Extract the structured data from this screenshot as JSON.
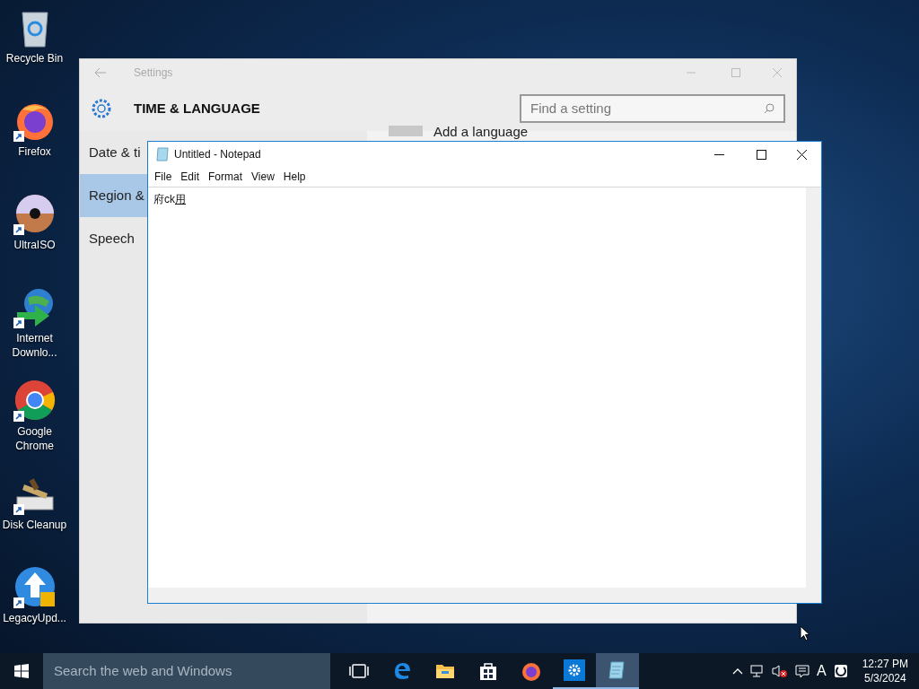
{
  "desktop_icons": [
    {
      "label": "Recycle Bin",
      "kind": "recycle",
      "shortcut": false
    },
    {
      "label": "Firefox",
      "kind": "firefox",
      "shortcut": true
    },
    {
      "label": "UltraISO",
      "kind": "disc",
      "shortcut": true
    },
    {
      "label": "Internet Downlo...",
      "kind": "globe",
      "shortcut": true
    },
    {
      "label": "Google Chrome",
      "kind": "chrome",
      "shortcut": true
    },
    {
      "label": "Disk Cleanup",
      "kind": "cleanup",
      "shortcut": true
    },
    {
      "label": "LegacyUpd...",
      "kind": "update",
      "shortcut": true
    }
  ],
  "settings": {
    "title": "Settings",
    "heading": "TIME & LANGUAGE",
    "search": {
      "placeholder": "Find a setting"
    },
    "nav": [
      {
        "label": "Date & ti",
        "selected": false
      },
      {
        "label": "Region &",
        "selected": true
      },
      {
        "label": "Speech",
        "selected": false
      }
    ],
    "content_link": "Add a language"
  },
  "notepad": {
    "title": "Untitled - Notepad",
    "menu": [
      "File",
      "Edit",
      "Format",
      "View",
      "Help"
    ],
    "text": "府ck",
    "composition": "用"
  },
  "taskbar": {
    "search": {
      "placeholder": "Search the web and Windows"
    },
    "apps": [
      {
        "kind": "taskview",
        "running": false,
        "selected": false
      },
      {
        "kind": "edge",
        "running": false,
        "selected": false
      },
      {
        "kind": "folder",
        "running": false,
        "selected": false
      },
      {
        "kind": "store",
        "running": false,
        "selected": false
      },
      {
        "kind": "firefox",
        "running": false,
        "selected": false
      },
      {
        "kind": "settings",
        "running": true,
        "selected": false
      },
      {
        "kind": "notepad",
        "running": true,
        "selected": true
      }
    ],
    "tray": {
      "ime": "A",
      "time": "12:27 PM",
      "date": "5/3/2024"
    }
  }
}
